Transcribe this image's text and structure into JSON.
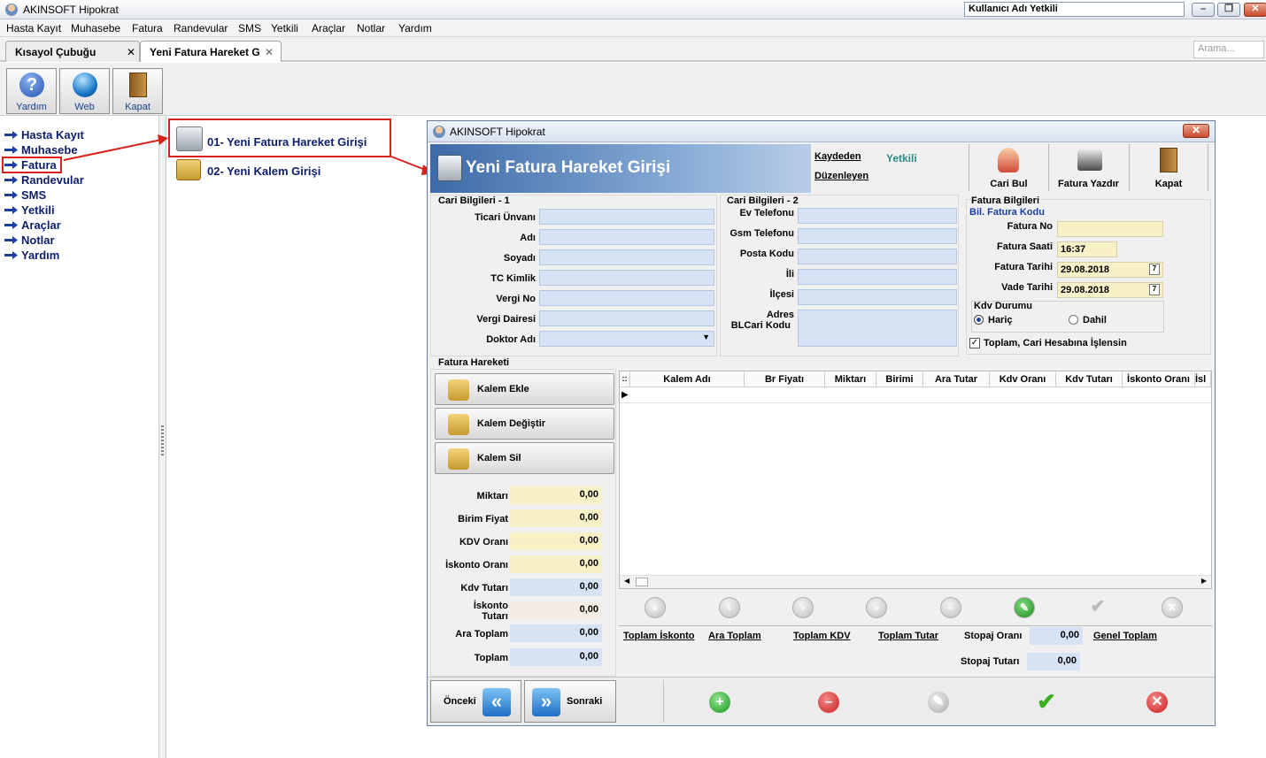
{
  "window": {
    "title": "AKINSOFT Hipokrat",
    "user_box": "Kullanıcı Adı Yetkili"
  },
  "menu": [
    "Hasta Kayıt",
    "Muhasebe",
    "Fatura",
    "Randevular",
    "SMS",
    "Yetkili",
    "Araçlar",
    "Notlar",
    "Yardım"
  ],
  "tabs": [
    {
      "label": "Kısayol Çubuğu"
    },
    {
      "label": "Yeni Fatura Hareket G"
    }
  ],
  "search": {
    "placeholder": "Arama..."
  },
  "toolbar": {
    "help": "Yardım",
    "web": "Web",
    "close": "Kapat"
  },
  "leftnav": [
    "Hasta Kayıt",
    "Muhasebe",
    "Fatura",
    "Randevular",
    "SMS",
    "Yetkili",
    "Araçlar",
    "Notlar",
    "Yardım"
  ],
  "launch": {
    "item1": "01- Yeni Fatura Hareket Girişi",
    "item2": "02- Yeni Kalem Girişi"
  },
  "dialog": {
    "title": "AKINSOFT Hipokrat",
    "banner": "Yeni Fatura Hareket Girişi",
    "kaydeden": "Kaydeden",
    "duzenleyen": "Düzenleyen",
    "kaydeden_value": "Yetkili",
    "btn_cari_bul": "Cari Bul",
    "btn_fatura_yazdir": "Fatura Yazdır",
    "btn_kapat": "Kapat",
    "cari1": {
      "title": "Cari Bilgileri - 1",
      "labels": [
        "Ticari Ünvanı",
        "Adı",
        "Soyadı",
        "TC Kimlik",
        "Vergi No",
        "Vergi Dairesi",
        "Doktor Adı"
      ]
    },
    "cari2": {
      "title": "Cari Bilgileri - 2",
      "labels": [
        "Ev Telefonu",
        "Gsm Telefonu",
        "Posta Kodu",
        "İli",
        "İlçesi"
      ],
      "adres": "Adres",
      "blcari": "BLCari Kodu"
    },
    "fatura": {
      "title": "Fatura Bilgileri",
      "bil_kodu": "Bil. Fatura Kodu",
      "no_label": "Fatura No",
      "saat_label": "Fatura Saati",
      "saat": "16:37",
      "tarih_label": "Fatura Tarihi",
      "tarih": "29.08.2018",
      "vade_label": "Vade Tarihi",
      "vade": "29.08.2018",
      "kdv_label": "Kdv Durumu",
      "haric": "Hariç",
      "dahil": "Dahil",
      "toplam_check": "Toplam, Cari Hesabına İşlensin"
    },
    "hareket": {
      "title": "Fatura Hareketi",
      "kalem_ekle": "Kalem Ekle",
      "kalem_degistir": "Kalem Değiştir",
      "kalem_sil": "Kalem Sil"
    },
    "totals": [
      {
        "label": "Miktarı",
        "value": "0,00"
      },
      {
        "label": "Birim Fiyat",
        "value": "0,00"
      },
      {
        "label": "KDV Oranı",
        "value": "0,00"
      },
      {
        "label": "İskonto Oranı",
        "value": "0,00"
      },
      {
        "label": "Kdv Tutarı",
        "value": "0,00"
      },
      {
        "label": "İskonto Tutarı",
        "value": "0,00"
      },
      {
        "label": "Ara Toplam",
        "value": "0,00"
      },
      {
        "label": "Toplam",
        "value": "0,00"
      }
    ],
    "grid_columns": [
      "Kalem Adı",
      "Br Fiyatı",
      "Miktarı",
      "Birimi",
      "Ara Tutar",
      "Kdv Oranı",
      "Kdv Tutarı",
      "İskonto Oranı",
      "İsl"
    ],
    "summary": {
      "toplam_iskonto": "Toplam İskonto",
      "ara_toplam": "Ara Toplam",
      "toplam_kdv": "Toplam KDV",
      "toplam_tutar": "Toplam Tutar",
      "stopaj_orani": "Stopaj Oranı",
      "stopaj_orani_value": "0,00",
      "genel_toplam": "Genel Toplam",
      "stopaj_tutari": "Stopaj Tutarı",
      "stopaj_tutari_value": "0,00"
    },
    "onceki": "Önceki",
    "sonraki": "Sonraki"
  }
}
